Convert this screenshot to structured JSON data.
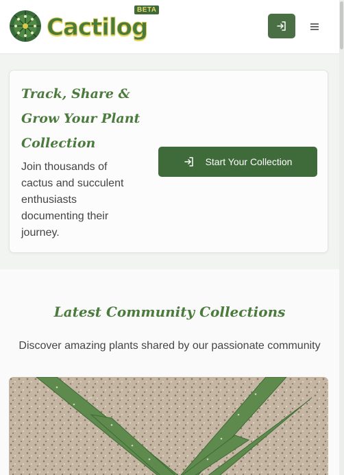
{
  "header": {
    "logo_text": "Cactilog",
    "beta_label": "BETA",
    "icons": {
      "logo": "cactus-logo-icon",
      "login": "login-icon",
      "menu": "hamburger-menu-icon"
    }
  },
  "hero": {
    "title": "Track, Share & Grow Your Plant Collection",
    "subtitle": "Join thousands of cactus and succulent enthusiasts documenting their journey.",
    "cta_label": "Start Your Collection",
    "cta_icon": "login-icon"
  },
  "community": {
    "title": "Latest Community Collections",
    "subtitle": "Discover amazing plants shared by our passionate community"
  },
  "colors": {
    "brand_green": "#4a7a3c",
    "button_green": "#3f6b3a",
    "accent_yellow": "#e8d96a"
  }
}
